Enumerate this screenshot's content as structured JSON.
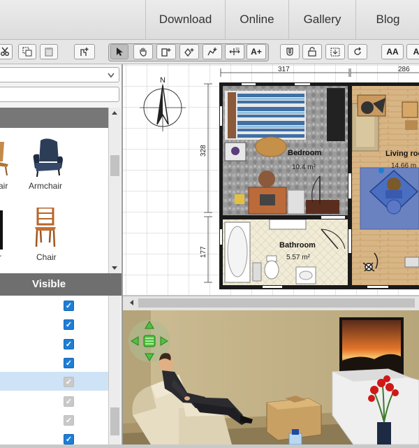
{
  "topnav": {
    "items": [
      "Download",
      "Online",
      "Gallery",
      "Blog"
    ]
  },
  "toolbar": {
    "add_text": "A+",
    "zoom_in": "AA",
    "zoom_out": "A"
  },
  "catalog": {
    "items": [
      {
        "label": "air"
      },
      {
        "label": "Armchair"
      },
      {
        "label": "r"
      },
      {
        "label": "Chair"
      }
    ]
  },
  "furniture_table": {
    "header": "Visible",
    "rows": [
      {
        "visible": true,
        "selected": false,
        "enabled": true
      },
      {
        "visible": true,
        "selected": false,
        "enabled": true
      },
      {
        "visible": true,
        "selected": false,
        "enabled": true
      },
      {
        "visible": true,
        "selected": false,
        "enabled": true
      },
      {
        "visible": true,
        "selected": true,
        "enabled": false
      },
      {
        "visible": true,
        "selected": false,
        "enabled": false
      },
      {
        "visible": true,
        "selected": false,
        "enabled": false
      },
      {
        "visible": true,
        "selected": false,
        "enabled": true
      }
    ]
  },
  "plan": {
    "compass_label": "N",
    "dimensions": {
      "top_left": "317",
      "top_right": "286",
      "left_upper": "328",
      "left_lower": "177"
    },
    "rooms": [
      {
        "name": "Bedroom",
        "area": "10.4 m²"
      },
      {
        "name": "Living roo",
        "area": "14.66 m"
      },
      {
        "name": "Bathroom",
        "area": "5.57 m²"
      }
    ]
  },
  "colors": {
    "accent_checkbox": "#1e7ed6",
    "selected_row": "#cfe3f7",
    "wall": "#1a1a1a"
  }
}
